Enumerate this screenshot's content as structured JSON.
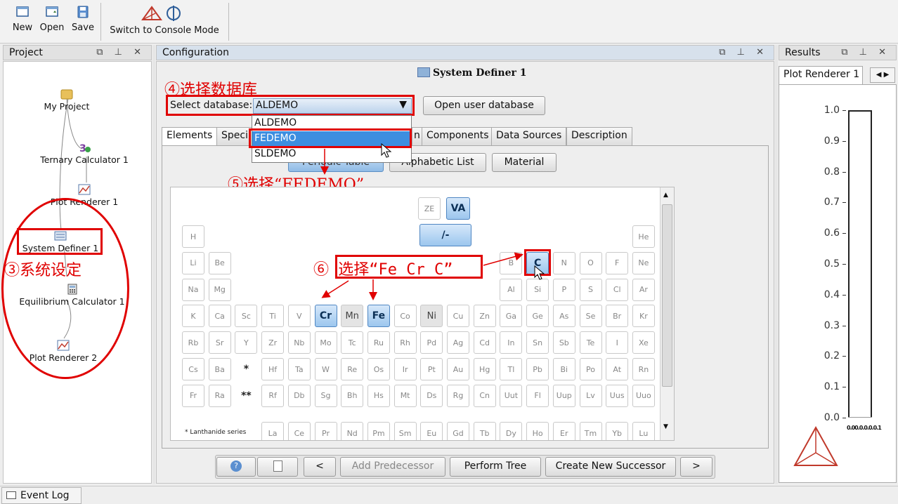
{
  "toolbar": {
    "new": "New",
    "open": "Open",
    "save": "Save",
    "console": "Switch to Console Mode"
  },
  "project": {
    "title": "Project",
    "controls": "⧉ ⊥ ✕",
    "nodes": [
      "My Project",
      "Ternary Calculator 1",
      "Plot Renderer 1",
      "System Definer 1",
      "Equilibrium Calculator 1",
      "Plot Renderer 2"
    ]
  },
  "config": {
    "title": "Configuration",
    "controls": "⧉ ⊥ ✕",
    "panel_title": "System Definer 1",
    "select_label": "Select database:",
    "selected_db": "ALDEMO",
    "db_options": [
      "ALDEMO",
      "FEDEMO",
      "SLDEMO"
    ],
    "open_user_db": "Open user database",
    "tabs": [
      "Elements",
      "Speci",
      "n",
      "Components",
      "Data Sources",
      "Description"
    ],
    "view_buttons": [
      "Periodic Table",
      "Alphabetic List",
      "Material"
    ],
    "special": [
      "ZE",
      "VA",
      "/-"
    ],
    "footnote": "* Lanthanide series",
    "rows": [
      [
        "H",
        "",
        "",
        "",
        "",
        "",
        "",
        "",
        "",
        "",
        "",
        "",
        "",
        "",
        "",
        "",
        "",
        "He"
      ],
      [
        "Li",
        "Be",
        "",
        "",
        "",
        "",
        "",
        "",
        "",
        "",
        "",
        "",
        "B",
        "C",
        "N",
        "O",
        "F",
        "Ne"
      ],
      [
        "Na",
        "Mg",
        "",
        "",
        "",
        "",
        "",
        "",
        "",
        "",
        "",
        "",
        "Al",
        "Si",
        "P",
        "S",
        "Cl",
        "Ar"
      ],
      [
        "K",
        "Ca",
        "Sc",
        "Ti",
        "V",
        "Cr",
        "Mn",
        "Fe",
        "Co",
        "Ni",
        "Cu",
        "Zn",
        "Ga",
        "Ge",
        "As",
        "Se",
        "Br",
        "Kr"
      ],
      [
        "Rb",
        "Sr",
        "Y",
        "Zr",
        "Nb",
        "Mo",
        "Tc",
        "Ru",
        "Rh",
        "Pd",
        "Ag",
        "Cd",
        "In",
        "Sn",
        "Sb",
        "Te",
        "I",
        "Xe"
      ],
      [
        "Cs",
        "Ba",
        "*",
        "Hf",
        "Ta",
        "W",
        "Re",
        "Os",
        "Ir",
        "Pt",
        "Au",
        "Hg",
        "Tl",
        "Pb",
        "Bi",
        "Po",
        "At",
        "Rn"
      ],
      [
        "Fr",
        "Ra",
        "**",
        "Rf",
        "Db",
        "Sg",
        "Bh",
        "Hs",
        "Mt",
        "Ds",
        "Rg",
        "Cn",
        "Uut",
        "Fl",
        "Uup",
        "Lv",
        "Uus",
        "Uuo"
      ]
    ],
    "lanthanides": [
      "La",
      "Ce",
      "Pr",
      "Nd",
      "Pm",
      "Sm",
      "Eu",
      "Gd",
      "Tb",
      "Dy",
      "Ho",
      "Er",
      "Tm",
      "Yb",
      "Lu"
    ],
    "bottom": {
      "help": "?",
      "blank": "",
      "prev": "<",
      "add_pred": "Add Predecessor",
      "perform": "Perform Tree",
      "create_succ": "Create New Successor",
      "next": ">"
    }
  },
  "results": {
    "title": "Results",
    "controls": "⧉ ⊥ ✕",
    "tab": "Plot Renderer 1",
    "ticks": [
      "1.0",
      "0.9",
      "0.8",
      "0.7",
      "0.6",
      "0.5",
      "0.4",
      "0.3",
      "0.2",
      "0.1",
      "0.0"
    ],
    "xtick": "0.00.0.0.0.0.1"
  },
  "annotations": {
    "a3": "③系统设定",
    "a4": "④选择数据库",
    "a5": "⑤选择“FEDEMO”",
    "a6": "⑥ 选择“Fe Cr C”"
  },
  "status": {
    "event_log": "Event Log"
  },
  "colors": {
    "accent_red": "#e00000",
    "selection_blue": "#3d8ee0",
    "header_blue": "#d7e1ec"
  }
}
